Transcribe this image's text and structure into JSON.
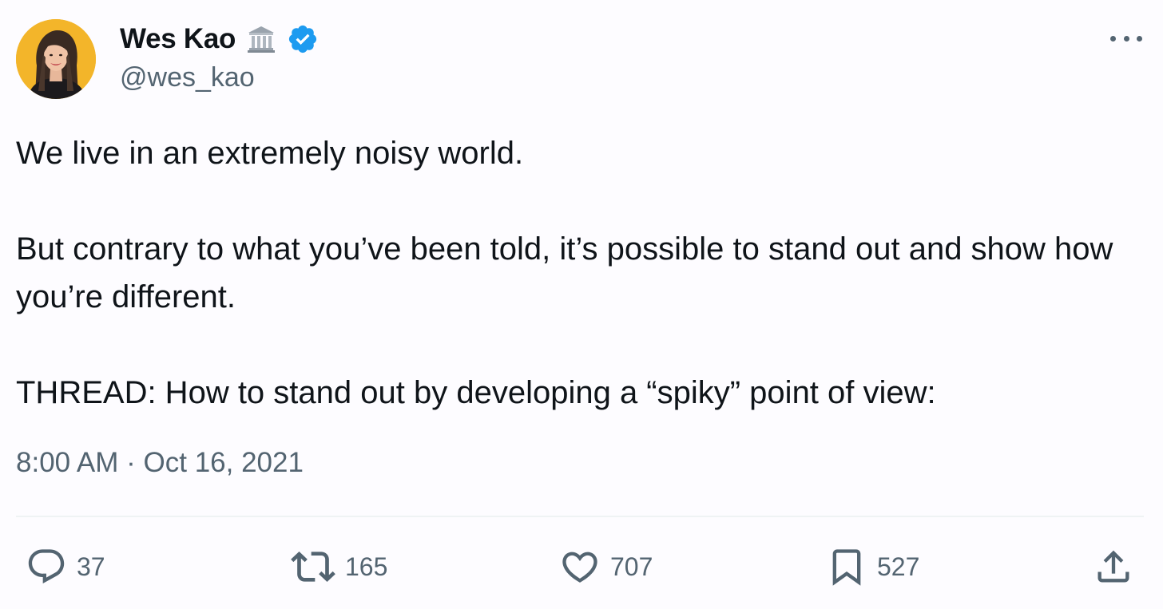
{
  "author": {
    "display_name": "Wes Kao",
    "handle": "@wes_kao",
    "badge_emoji": "classical-building-emoji",
    "verified": true,
    "verified_color": "#1d9bf0"
  },
  "tweet": {
    "paragraphs": [
      "We live in an extremely noisy world.",
      "But contrary to what you’ve been told, it’s possible to stand out and show how you’re different.",
      "THREAD: How to stand out by developing a “spiky” point of view:"
    ],
    "timestamp": "8:00 AM · Oct 16, 2021"
  },
  "actions": {
    "replies": "37",
    "retweets": "165",
    "likes": "707",
    "bookmarks": "527"
  },
  "colors": {
    "text": "#0f1419",
    "secondary": "#536471",
    "background": "#fdfcff",
    "avatar_bg": "#f3b52a"
  },
  "icons": [
    "more-icon",
    "reply-icon",
    "retweet-icon",
    "like-icon",
    "bookmark-icon",
    "share-icon"
  ]
}
